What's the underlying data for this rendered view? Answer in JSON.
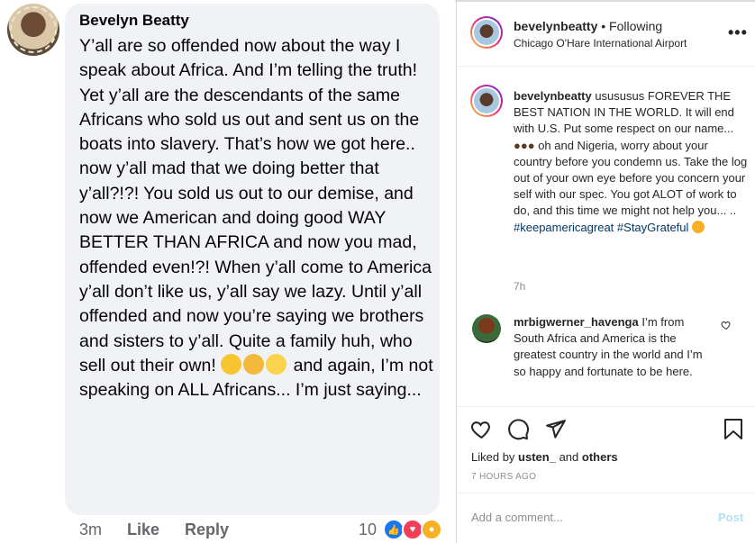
{
  "facebook_comment": {
    "author": "Bevelyn Beatty",
    "text_before_emojis": "Y’all are so offended now about the way I speak about Africa. And I’m telling the truth! Yet y’all are the descendants of the same Africans who sold us out and sent us on the boats into slavery. That’s how we got here.. now y’all mad that we doing better that y’all?!?! You sold us out to our demise, and now we American and doing good WAY BETTER THAN AFRICA and now you mad, offended even!?! When y’all come to America y’all don’t like us, y’all say we lazy. Until y’all offended and now you’re saying we brothers and sisters to y’all. Quite a family huh, who sell out their own!",
    "emojis": [
      "face-with-monocle-emoji",
      "thinking-face-emoji",
      "tears-of-joy-emoji"
    ],
    "text_after_emojis": "and again, I’m not speaking on ALL Africans... I’m just saying...",
    "time": "3m",
    "like_label": "Like",
    "reply_label": "Reply",
    "reaction_count": "10",
    "reactions": [
      "like-reaction-icon",
      "love-reaction-icon",
      "care-reaction-icon"
    ]
  },
  "instagram": {
    "header": {
      "username": "bevelynbeatty",
      "follow_status": "• Following",
      "location": "Chicago O'Hare International Airport",
      "more_label": "•••"
    },
    "caption": {
      "username": "bevelynbeatty",
      "text_1": "usususus FOREVER THE BEST NATION IN THE WORLD. It will end with U.S. Put some respect on our name...",
      "text_2": "oh and Nigeria, worry about your country before you condemn us. Take the log out of your own eye before you concern your self with our spec. You got ALOT of work to do, and this time we might not help you... ..",
      "hashtag_1": "#keepamericagreat",
      "hashtag_2": "#StayGrateful",
      "time": "7h"
    },
    "comment": {
      "username": "mrbigwerner_havenga",
      "text": "I’m from South Africa and America is the greatest country in the world and I’m so happy and fortunate to be here."
    },
    "likes": {
      "prefix": "Liked by",
      "user": "usten_",
      "joiner": "and",
      "others": "others"
    },
    "time_ago": "7 HOURS AGO",
    "add_comment_placeholder": "Add a comment...",
    "post_label": "Post",
    "colors": {
      "link": "#00376b",
      "post_disabled": "#b2dffc",
      "muted": "#8e8e8e"
    }
  }
}
